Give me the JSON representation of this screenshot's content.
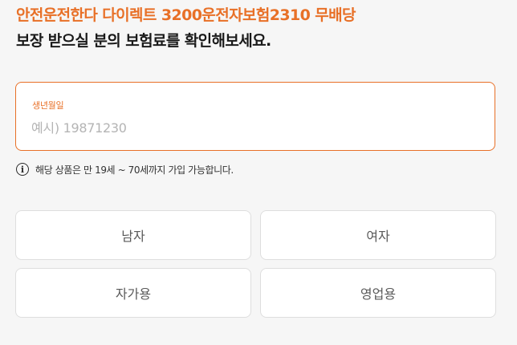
{
  "header": {
    "product_title": "안전운전한다 다이렉트 3200운전자보험2310 무배당",
    "subtitle": "보장 받으실 분의 보험료를 확인해보세요."
  },
  "birth_field": {
    "label": "생년월일",
    "placeholder": "예시) 19871230",
    "value": ""
  },
  "notice": {
    "icon": "info-icon",
    "text": "해당 상품은 만 19세 ~ 70세까지 가입 가능합니다."
  },
  "gender": {
    "male_label": "남자",
    "female_label": "여자"
  },
  "vehicle_use": {
    "private_label": "자가용",
    "commercial_label": "영업용"
  },
  "colors": {
    "accent": "#e87027",
    "background": "#f6f6f6",
    "option_border": "#dedede"
  }
}
